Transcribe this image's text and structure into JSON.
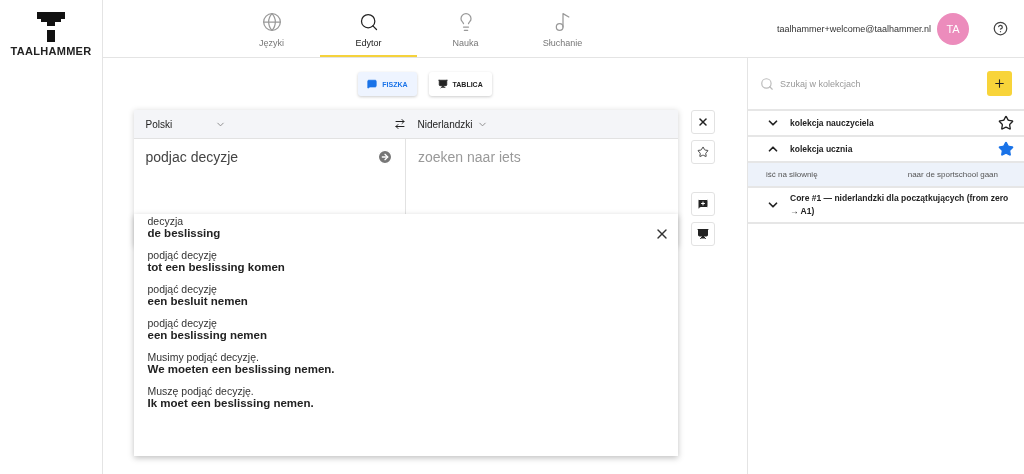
{
  "logo": {
    "text": "TAALHAMMER"
  },
  "nav": [
    {
      "label": "Języki",
      "selected": false
    },
    {
      "label": "Edytor",
      "selected": true
    },
    {
      "label": "Nauka",
      "selected": false
    },
    {
      "label": "Słuchanie",
      "selected": false
    }
  ],
  "user": {
    "email": "taalhammer+welcome@taalhammer.nl",
    "initials": "TA"
  },
  "modes": [
    {
      "label": "FISZKA",
      "selected": true
    },
    {
      "label": "TABLICA",
      "selected": false
    }
  ],
  "editor": {
    "source_language": "Polski",
    "target_language": "Niderlandzki",
    "source_text": "podjac decyzje",
    "target_placeholder": "zoeken naar iets"
  },
  "suggestions": [
    {
      "source": "decyzja",
      "target": "de beslissing"
    },
    {
      "source": "podjąć decyzję",
      "target": "tot een beslissing komen"
    },
    {
      "source": "podjąć decyzję",
      "target": "een besluit nemen"
    },
    {
      "source": "podjąć decyzję",
      "target": "een beslissing nemen"
    },
    {
      "source": "Musimy podjąć decyzję.",
      "target": "We moeten een beslissing nemen."
    },
    {
      "source": "Muszę podjąć decyzję.",
      "target": "Ik moet een beslissing nemen."
    }
  ],
  "collections": {
    "search_placeholder": "Szukaj w kolekcjach",
    "items": [
      {
        "name": "kolekcja nauczyciela",
        "expanded": false,
        "starred": false
      },
      {
        "name": "kolekcja ucznia",
        "expanded": true,
        "starred": true,
        "children": [
          {
            "source": "iść na siłownię",
            "target": "naar de sportschool gaan"
          }
        ]
      },
      {
        "name": "Core #1 — niderlandzki dla początkujących (from zero → A1)",
        "expanded": false
      }
    ]
  }
}
